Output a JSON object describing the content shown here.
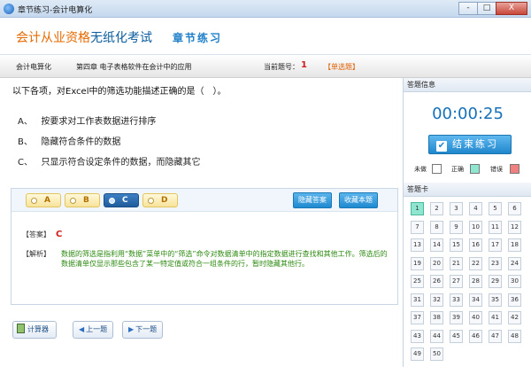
{
  "window": {
    "title": "章节练习-会计电算化",
    "buttons": [
      "-",
      "□",
      "X"
    ]
  },
  "header": {
    "logo_orange": "会计从业资格",
    "logo_blue": "无纸化考试",
    "section": "章节练习"
  },
  "infobar": {
    "subject": "会计电算化",
    "chapter": "第四章 电子表格软件在会计中的应用",
    "qno_label": "当前题号：",
    "qno": "1",
    "qtype": "【单选题】"
  },
  "question": {
    "stem": "以下各项，对Excel中的筛选功能描述正确的是（　）。",
    "options": [
      {
        "key": "A、",
        "text": "按要求对工作表数据进行排序"
      },
      {
        "key": "B、",
        "text": "隐藏符合条件的数据"
      },
      {
        "key": "C、",
        "text": "只显示符合设定条件的数据，而隐藏其它"
      }
    ]
  },
  "answer_buttons": [
    "A",
    "B",
    "C",
    "D"
  ],
  "panel": {
    "hide_answer": "隐藏答案",
    "favorite": "收藏本题",
    "answer_label": "【答案】",
    "answer": "C",
    "exp_label": "【解析】",
    "explanation": "数据的筛选是指利用“数据”菜单中的“筛选”命令对数据清单中的指定数据进行查找和其他工作。筛选后的数据清单仅显示那些包含了某一特定值或符合一组条件的行，暂时隐藏其他行。"
  },
  "bottom": {
    "calc": "计算器",
    "prev": "上一题",
    "next": "下一题"
  },
  "side": {
    "info_title": "答题信息",
    "timer": "00:00:25",
    "end": "结束练习",
    "card_title": "答题卡",
    "legend": [
      {
        "label": "未做",
        "color": "#ffffff"
      },
      {
        "label": "正确",
        "color": "#8fe6d0"
      },
      {
        "label": "错误",
        "color": "#f08080"
      }
    ],
    "numbers": [
      "1",
      "2",
      "3",
      "4",
      "5",
      "6",
      "7",
      "8",
      "9",
      "10",
      "11",
      "12",
      "13",
      "14",
      "15",
      "16",
      "17",
      "18",
      "19",
      "20",
      "21",
      "22",
      "23",
      "24",
      "25",
      "26",
      "27",
      "28",
      "29",
      "30",
      "31",
      "32",
      "33",
      "34",
      "35",
      "36",
      "37",
      "38",
      "39",
      "40",
      "41",
      "42",
      "43",
      "44",
      "45",
      "46",
      "47",
      "48",
      "49",
      "50"
    ],
    "current": "1"
  }
}
